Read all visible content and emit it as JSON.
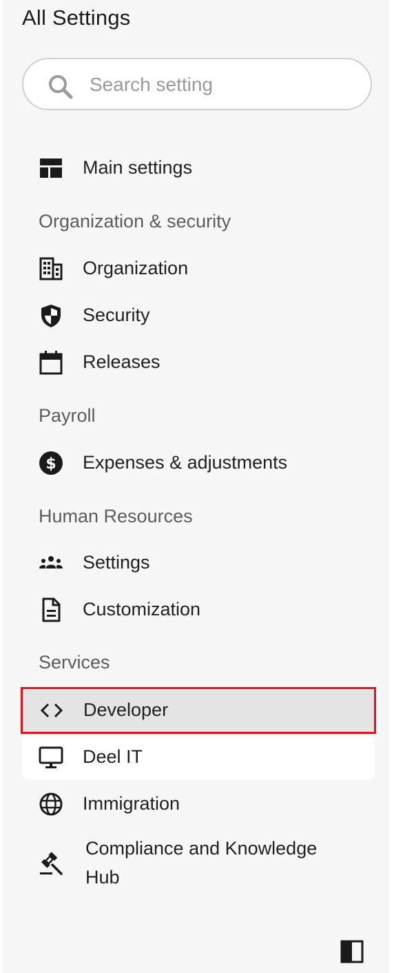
{
  "header": {
    "title": "All Settings"
  },
  "search": {
    "placeholder": "Search setting",
    "value": ""
  },
  "nav": {
    "main_settings": "Main settings",
    "sections": {
      "org_security": "Organization & security",
      "payroll": "Payroll",
      "hr": "Human Resources",
      "services": "Services"
    },
    "items": {
      "organization": "Organization",
      "security": "Security",
      "releases": "Releases",
      "expenses": "Expenses & adjustments",
      "hr_settings": "Settings",
      "customization": "Customization",
      "developer": "Developer",
      "deel_it": "Deel IT",
      "immigration": "Immigration",
      "compliance": "Compliance and Knowledge Hub"
    },
    "selected": "developer"
  },
  "colors": {
    "panel_bg": "#f7f7f7",
    "selected_bg": "#e4e4e4",
    "highlight_border": "#e0121a",
    "section_text": "#5c5c5c"
  },
  "icons": {
    "search": "search-icon",
    "main_settings": "dashboard-icon",
    "organization": "building-icon",
    "security": "shield-icon",
    "releases": "calendar-icon",
    "expenses": "dollar-circle-icon",
    "hr_settings": "people-icon",
    "customization": "document-icon",
    "developer": "code-icon",
    "deel_it": "monitor-icon",
    "immigration": "globe-icon",
    "compliance": "gavel-icon",
    "collapse": "sidebar-collapse-icon"
  }
}
